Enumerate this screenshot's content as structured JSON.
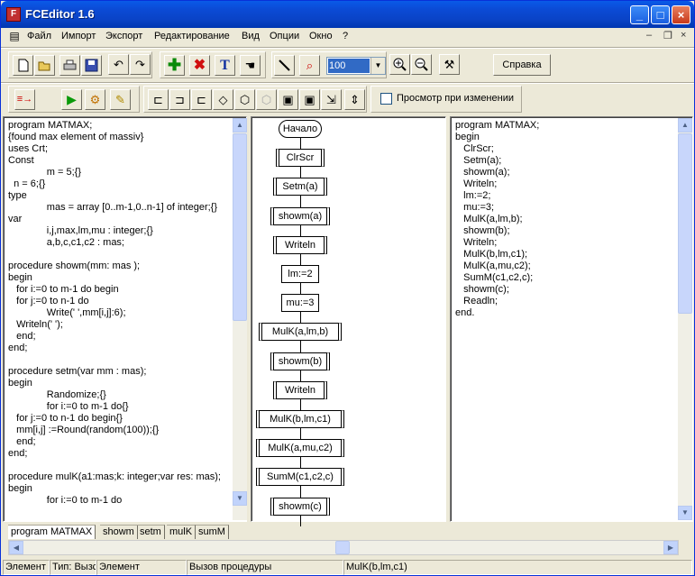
{
  "window": {
    "title": "FCEditor 1.6"
  },
  "menu": [
    "Файл",
    "Импорт",
    "Экспорт",
    "Редактирование",
    "Вид",
    "Опции",
    "Окно",
    "?"
  ],
  "toolbar": {
    "zoom": "100",
    "help_label": "Справка",
    "preview_label": "Просмотр при изменении"
  },
  "source_code": "program MATMAX;\n{found max element of massiv}\nuses Crt;\nConst\n              m = 5;{}\n  n = 6;{}\ntype\n              mas = array [0..m-1,0..n-1] of integer;{}\nvar\n              i,j,max,lm,mu : integer;{}\n              a,b,c,c1,c2 : mas;\n\nprocedure showm(mm: mas );\nbegin\n   for i:=0 to m-1 do begin\n   for j:=0 to n-1 do\n              Write(' ',mm[i,j]:6);\n   Writeln(' ');\n   end;\nend;\n\nprocedure setm(var mm : mas);\nbegin\n              Randomize;{}\n              for i:=0 to m-1 do{}\n   for j:=0 to n-1 do begin{}\n   mm[i,j] :=Round(random(100));{}\n   end;\nend;\n\nprocedure mulK(a1:mas;k: integer;var res: mas);\nbegin\n              for i:=0 to m-1 do",
  "flowchart": [
    {
      "label": "Начало",
      "kind": "term"
    },
    {
      "label": "ClrScr",
      "kind": "proc"
    },
    {
      "label": "Setm(a)",
      "kind": "proc"
    },
    {
      "label": "showm(a)",
      "kind": "proc"
    },
    {
      "label": "Writeln",
      "kind": "proc"
    },
    {
      "label": "lm:=2",
      "kind": "op"
    },
    {
      "label": "mu:=3",
      "kind": "op"
    },
    {
      "label": "MulK(a,lm,b)",
      "kind": "proc"
    },
    {
      "label": "showm(b)",
      "kind": "proc"
    },
    {
      "label": "Writeln",
      "kind": "proc"
    },
    {
      "label": "MulK(b,lm,c1)",
      "kind": "proc"
    },
    {
      "label": "MulK(a,mu,c2)",
      "kind": "proc"
    },
    {
      "label": "SumM(c1,c2,c)",
      "kind": "proc"
    },
    {
      "label": "showm(c)",
      "kind": "proc"
    }
  ],
  "result_code": "program MATMAX;\nbegin\n   ClrScr;\n   Setm(a);\n   showm(a);\n   Writeln;\n   lm:=2;\n   mu:=3;\n   MulK(a,lm,b);\n   showm(b);\n   Writeln;\n   MulK(b,lm,c1);\n   MulK(a,mu,c2);\n   SumM(c1,c2,c);\n   showm(c);\n   Readln;\nend.",
  "tabs": [
    "program MATMAX",
    "showm",
    "setm",
    "mulK",
    "sumM"
  ],
  "status": [
    "Элемент",
    "Тип: Вызс",
    "Элемент",
    "Вызов процедуры",
    "MulK(b,lm,c1)"
  ]
}
